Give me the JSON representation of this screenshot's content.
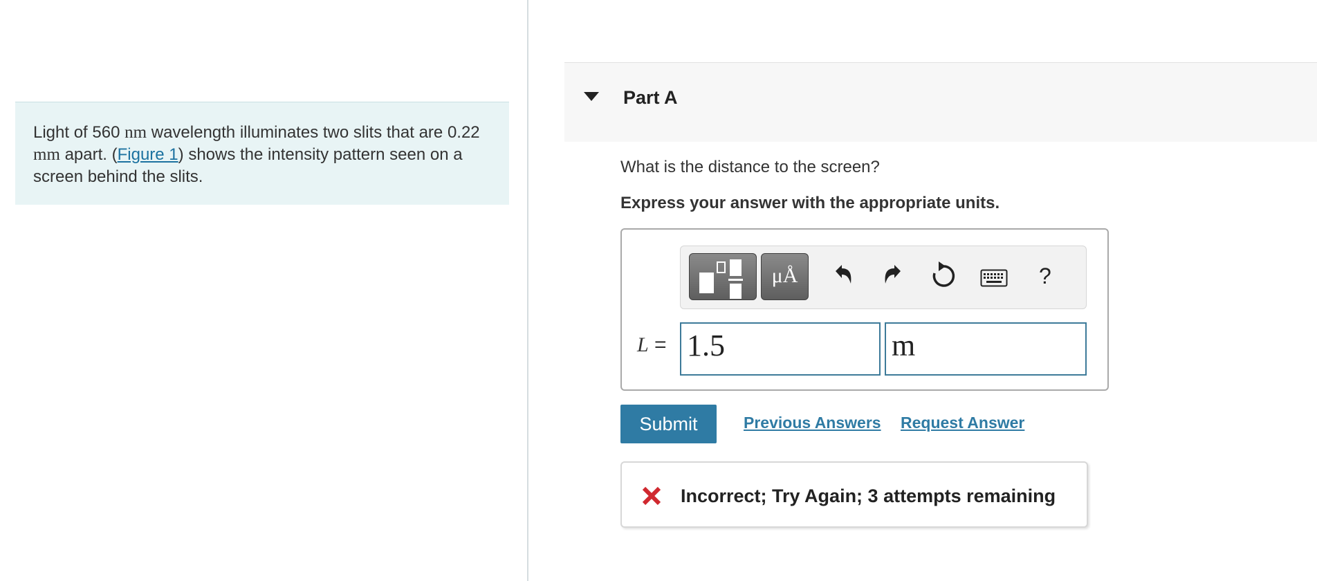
{
  "problem": {
    "text_1": "Light of 560 ",
    "unit_nm": "nm",
    "text_2": " wavelength illuminates two slits that are ",
    "value_sep": "0.22 ",
    "unit_mm": "mm",
    "text_3": " apart. (",
    "figure_link": "Figure 1",
    "text_4": ") shows the intensity pattern seen on a screen behind the slits."
  },
  "part": {
    "title": "Part A",
    "question": "What is the distance to the screen?",
    "instruction": "Express your answer with the appropriate units."
  },
  "toolbar": {
    "units_label": "μÅ",
    "help_label": "?",
    "icons": [
      "templates-icon",
      "units-icon",
      "undo-icon",
      "redo-icon",
      "reset-icon",
      "keyboard-icon",
      "help-icon"
    ]
  },
  "answer": {
    "variable": "L",
    "equals": " =",
    "value": "1.5",
    "units": "m"
  },
  "actions": {
    "submit_label": "Submit",
    "previous_answers_label": "Previous Answers",
    "request_answer_label": "Request Answer"
  },
  "feedback": {
    "message": "Incorrect; Try Again; 3 attempts remaining",
    "status_color": "#d0282f"
  },
  "colors": {
    "accent": "#2f7ba4",
    "panel_bg": "#e8f4f5"
  }
}
